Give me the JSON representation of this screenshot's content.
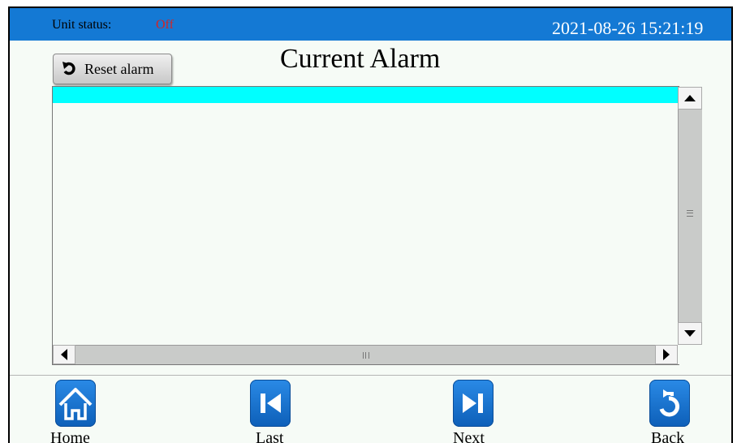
{
  "status_bar": {
    "unit_status_label": "Unit status:",
    "unit_status_value": "Off",
    "datetime": "2021-08-26  15:21:19",
    "bar_color": "#1479d4",
    "status_value_color": "#d42424"
  },
  "toolbar": {
    "reset_label": "Reset alarm",
    "reset_icon": "undo-icon"
  },
  "page_title": "Current Alarm",
  "alarm_list": {
    "rows": [],
    "selected_row_color": "#00ffff",
    "icons": {
      "up": "scroll-up-arrow-icon",
      "down": "scroll-down-arrow-icon",
      "left": "scroll-left-arrow-icon",
      "right": "scroll-right-arrow-icon"
    }
  },
  "nav": {
    "home": {
      "label": "Home",
      "icon": "home-icon"
    },
    "last": {
      "label": "Last",
      "icon": "skip-previous-icon"
    },
    "next": {
      "label": "Next",
      "icon": "skip-next-icon"
    },
    "back": {
      "label": "Back",
      "icon": "return-arrow-icon"
    }
  }
}
